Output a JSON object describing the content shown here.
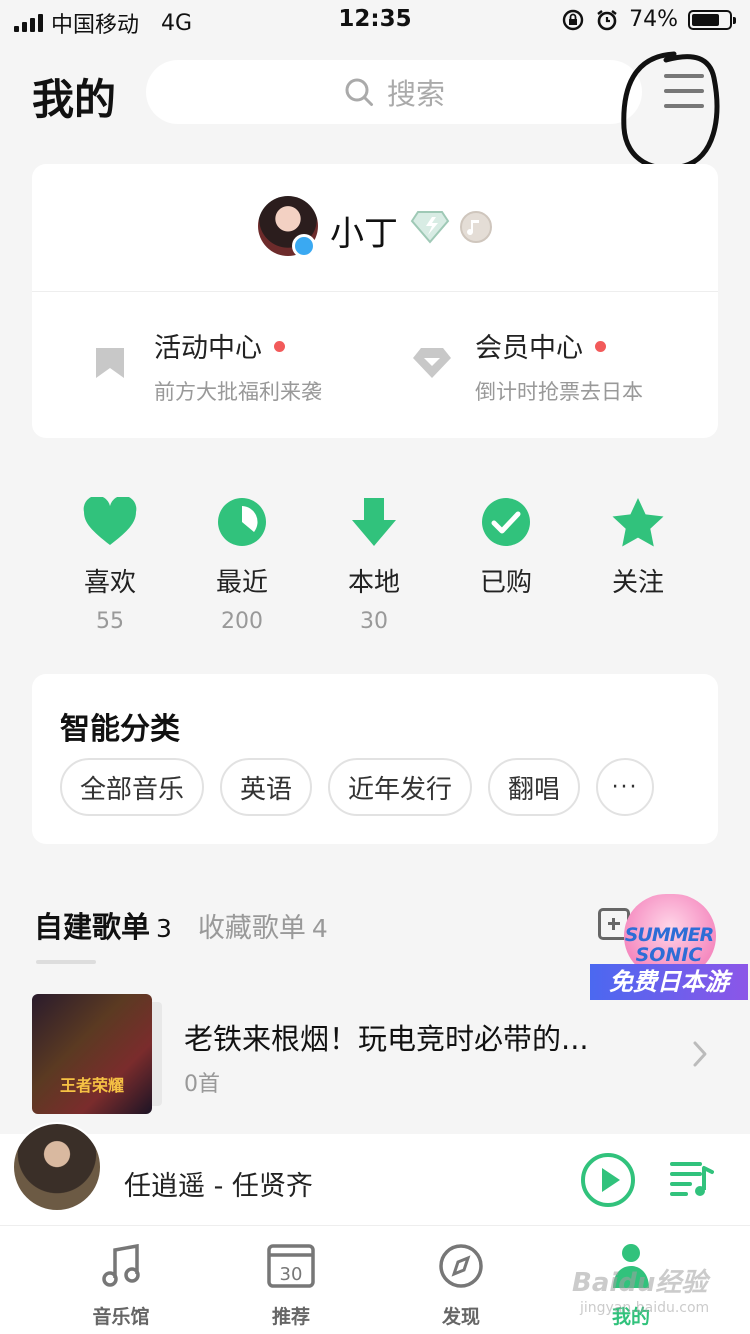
{
  "status_bar": {
    "carrier": "中国移动",
    "network": "4G",
    "time": "12:35",
    "battery": "74%",
    "battery_level": 0.74
  },
  "header": {
    "title": "我的",
    "search_placeholder": "搜索"
  },
  "profile": {
    "username": "小丁",
    "promos": [
      {
        "title": "活动中心",
        "subtitle": "前方大批福利来袭",
        "icon": "bookmark-icon"
      },
      {
        "title": "会员中心",
        "subtitle": "倒计时抢票去日本",
        "icon": "diamond-icon"
      }
    ]
  },
  "shortcuts": [
    {
      "label": "喜欢",
      "count": "55",
      "icon": "heart-icon"
    },
    {
      "label": "最近",
      "count": "200",
      "icon": "clock-icon"
    },
    {
      "label": "本地",
      "count": "30",
      "icon": "download-icon"
    },
    {
      "label": "已购",
      "count": "",
      "icon": "check-icon"
    },
    {
      "label": "关注",
      "count": "",
      "icon": "star-icon"
    }
  ],
  "smart_category": {
    "title": "智能分类",
    "chips": [
      "全部音乐",
      "英语",
      "近年发行",
      "翻唱"
    ],
    "more": "···"
  },
  "playlists": {
    "tabs": [
      {
        "label": "自建歌单",
        "count": "3"
      },
      {
        "label": "收藏歌单",
        "count": "4"
      }
    ],
    "ad": {
      "line1": "SUMMER",
      "line2": "SONIC",
      "banner": "免费日本游"
    },
    "items": [
      {
        "name": "老铁来根烟！玩电竞时必带的...",
        "count": "0首",
        "cover_text": "王者荣耀"
      }
    ]
  },
  "player": {
    "now_playing": "任逍遥 - 任贤齐"
  },
  "tabbar": {
    "items": [
      {
        "label": "音乐馆",
        "icon": "music-note-icon"
      },
      {
        "label": "推荐",
        "icon": "calendar-icon",
        "icon_text": "30"
      },
      {
        "label": "发现",
        "icon": "compass-icon"
      },
      {
        "label": "我的",
        "icon": "profile-icon"
      }
    ],
    "active_index": 3
  },
  "watermark": {
    "text": "Baidu经验",
    "sub": "jingyan.baidu.com"
  },
  "colors": {
    "accent": "#31c27c",
    "dot": "#f25a5a"
  }
}
